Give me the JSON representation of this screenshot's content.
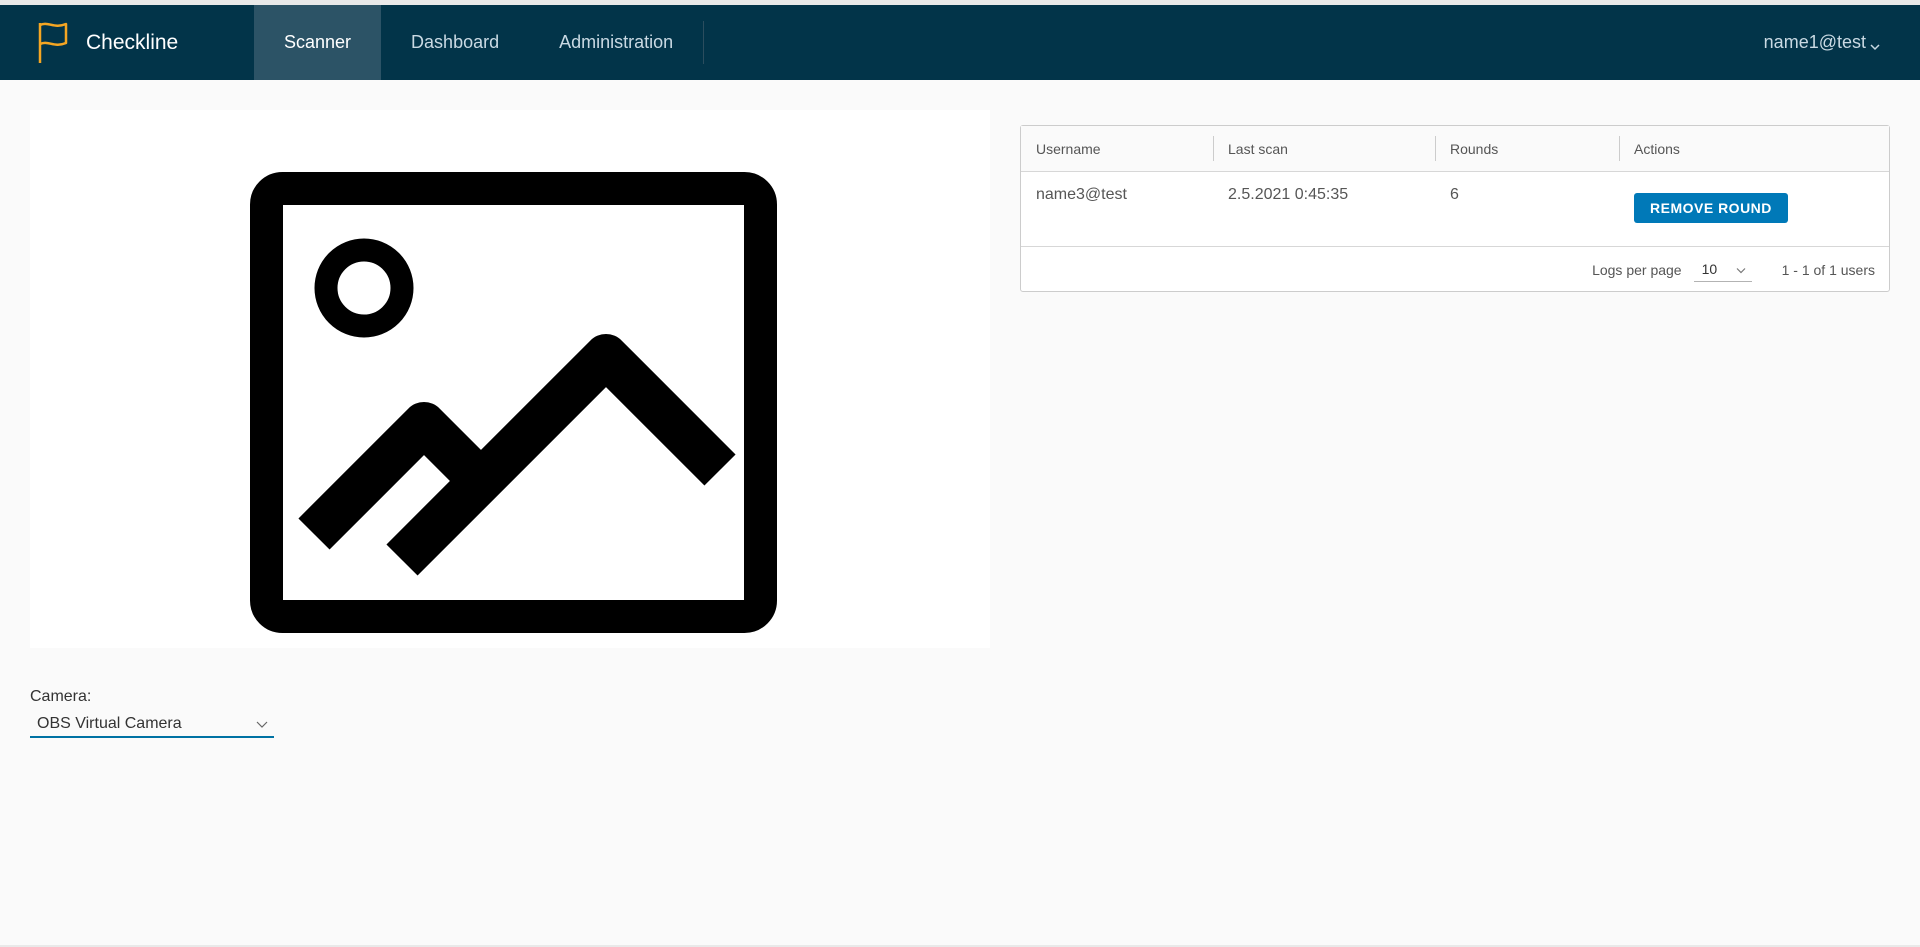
{
  "app": {
    "name": "Checkline"
  },
  "nav": {
    "items": [
      {
        "label": "Scanner",
        "active": true
      },
      {
        "label": "Dashboard",
        "active": false
      },
      {
        "label": "Administration",
        "active": false
      }
    ]
  },
  "user": {
    "name": "name1@test"
  },
  "camera": {
    "label": "Camera:",
    "selected": "OBS Virtual Camera"
  },
  "grid": {
    "columns": [
      "Username",
      "Last scan",
      "Rounds",
      "Actions"
    ],
    "rows": [
      {
        "username": "name3@test",
        "last_scan": "2.5.2021 0:45:35",
        "rounds": "6",
        "action_label": "REMOVE ROUND"
      }
    ],
    "footer": {
      "per_page_label": "Logs per page",
      "per_page_value": "10",
      "range_text": "1 - 1 of 1 users"
    }
  },
  "icons": {
    "brand": "flag-icon",
    "user_dropdown": "chevron-down-icon",
    "placeholder": "image-placeholder-icon"
  },
  "colors": {
    "header_bg": "#023449",
    "nav_active_bg": "#2c5366",
    "brand_accent": "#f5a623",
    "button_primary": "#0079b8",
    "select_underline": "#0072a3"
  }
}
